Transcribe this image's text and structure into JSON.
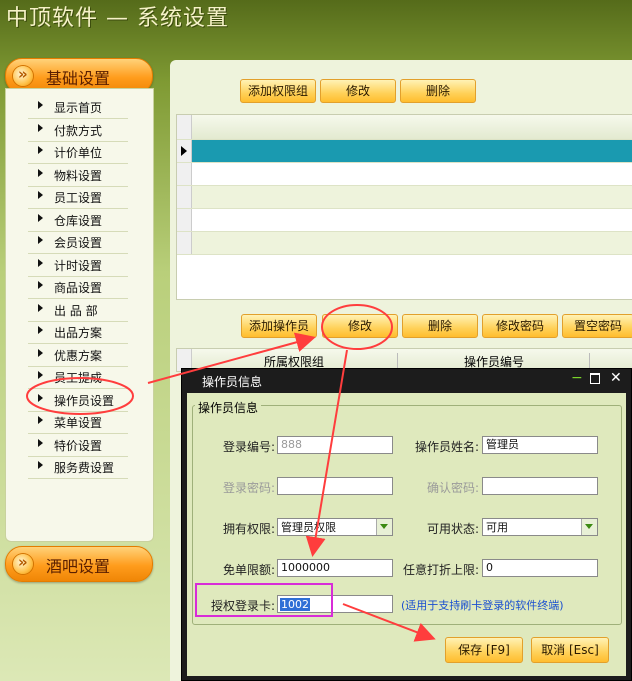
{
  "header": {
    "title": "中顶软件 — 系统设置"
  },
  "sidebar": {
    "group1": "基础设置",
    "items": [
      "显示首页",
      "付款方式",
      "计价单位",
      "物料设置",
      "员工设置",
      "仓库设置",
      "会员设置",
      "计时设置",
      "商品设置",
      "出 品 部",
      "出品方案",
      "优惠方案",
      "员工提成",
      "操作员设置",
      "菜单设置",
      "特价设置",
      "服务费设置"
    ],
    "group2": "酒吧设置"
  },
  "top_toolbar": {
    "add_group": "添加权限组",
    "edit": "修改",
    "delete": "删除"
  },
  "bottom_toolbar": {
    "add_operator": "添加操作员",
    "edit": "修改",
    "delete": "删除",
    "change_password": "修改密码",
    "clear_password": "置空密码"
  },
  "grid2": {
    "columns": [
      "所属权限组",
      "操作员编号"
    ]
  },
  "dialog": {
    "title": "操作员信息",
    "group_title": "操作员信息",
    "login_no_label": "登录编号:",
    "login_no_value": "888",
    "name_label": "操作员姓名:",
    "name_value": "管理员",
    "password_label": "登录密码:",
    "confirm_label": "确认密码:",
    "permission_label": "拥有权限:",
    "permission_value": "管理员权限",
    "status_label": "可用状态:",
    "status_value": "可用",
    "free_limit_label": "免单限额:",
    "free_limit_value": "1000000",
    "discount_label": "任意打折上限:",
    "discount_value": "0",
    "card_label": "授权登录卡:",
    "card_value": "1002",
    "card_note": "(适用于支持刷卡登录的软件终端)",
    "save": "保存 [F9]",
    "cancel": "取消 [Esc]"
  },
  "colors": {
    "accent": "#ff9c1c",
    "selected_row": "#1a9ab0",
    "annotation": "#ff3d3d",
    "highlight_box": "#d82cd8"
  }
}
